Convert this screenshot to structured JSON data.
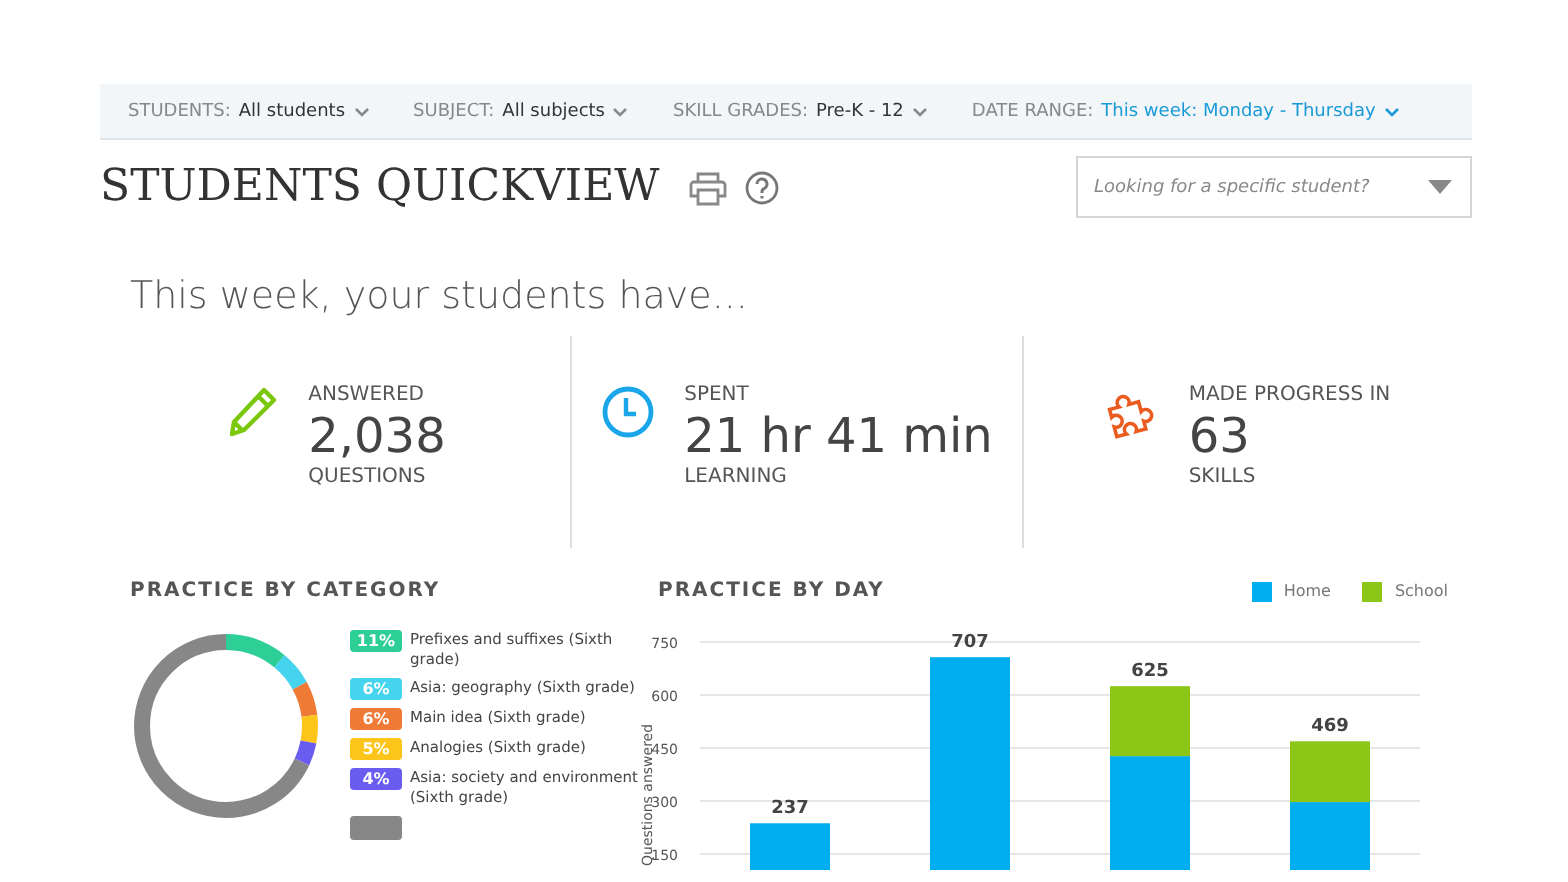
{
  "filters": [
    {
      "label": "STUDENTS:",
      "value": "All students",
      "highlighted": false
    },
    {
      "label": "SUBJECT:",
      "value": "All subjects",
      "highlighted": false
    },
    {
      "label": "SKILL GRADES:",
      "value": "Pre-K - 12",
      "highlighted": false
    },
    {
      "label": "DATE RANGE:",
      "value": "This week: Monday - Thursday",
      "highlighted": true
    }
  ],
  "title": "STUDENTS QUICKVIEW",
  "search": {
    "placeholder": "Looking for a specific student?"
  },
  "intro": "This week, your students have...",
  "stats": [
    {
      "kind": "pencil",
      "label": "ANSWERED",
      "value": "2,038",
      "unit": "QUESTIONS"
    },
    {
      "kind": "clock",
      "label": "SPENT",
      "value": "21 hr 41 min",
      "unit": "LEARNING"
    },
    {
      "kind": "puzzle",
      "label": "MADE PROGRESS IN",
      "value": "63",
      "unit": "SKILLS"
    }
  ],
  "category": {
    "title": "PRACTICE BY CATEGORY",
    "items": [
      {
        "percent": "11%",
        "label": "Prefixes and suffixes (Sixth grade)",
        "color": "#2ecf96"
      },
      {
        "percent": "6%",
        "label": "Asia: geography (Sixth grade)",
        "color": "#45d4ee"
      },
      {
        "percent": "6%",
        "label": "Main idea (Sixth grade)",
        "color": "#ef7a35"
      },
      {
        "percent": "5%",
        "label": "Analogies (Sixth grade)",
        "color": "#fdc51a"
      },
      {
        "percent": "4%",
        "label": "Asia: society and environment (Sixth grade)",
        "color": "#6a5cf0"
      },
      {
        "color": "#878787"
      }
    ]
  },
  "by_day": {
    "title": "PRACTICE BY DAY",
    "chart_data": {
      "type": "bar",
      "stacked": true,
      "grid": true,
      "ylabel": "Questions answered",
      "series": [
        {
          "name": "Home",
          "color": "#00aeef",
          "values": [
            237,
            707,
            427,
            297
          ]
        },
        {
          "name": "School",
          "color": "#8cc617",
          "values": [
            null,
            null,
            198,
            172
          ]
        }
      ],
      "ylim": [
        150,
        750
      ],
      "yticks": [
        150,
        300,
        450,
        600,
        750
      ],
      "value_labels": [
        "237",
        "707",
        "625",
        "469"
      ]
    }
  }
}
